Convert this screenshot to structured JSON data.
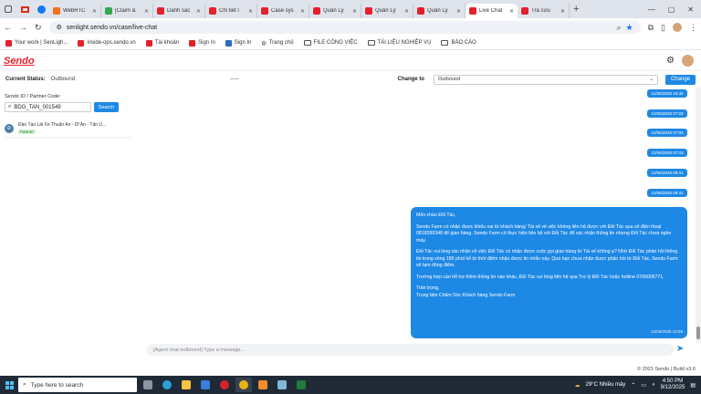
{
  "browser": {
    "tabs": [
      {
        "title": "WebRTC",
        "color": "#f2711c"
      },
      {
        "title": "[Claim &",
        "color": "#34a853"
      },
      {
        "title": "Danh sác",
        "color": "#e3212c"
      },
      {
        "title": "Chi tiết l",
        "color": "#e3212c"
      },
      {
        "title": "Case sys",
        "color": "#e3212c"
      },
      {
        "title": "Quản Lý",
        "color": "#e3212c"
      },
      {
        "title": "Quản Lý",
        "color": "#e3212c"
      },
      {
        "title": "Quản Lý",
        "color": "#e3212c"
      },
      {
        "title": "Live Chat",
        "color": "#e3212c"
      },
      {
        "title": "Tra cứu",
        "color": "#e3212c"
      }
    ],
    "url": "senlight.sendo.vn/case/live-chat",
    "bookmarks": [
      {
        "label": "Your work | SenLigh...",
        "icon": "sendo-icon"
      },
      {
        "label": "inside-ops.sendo.vn",
        "icon": "sendo-icon"
      },
      {
        "label": "Tài khoản",
        "icon": "sendo-icon"
      },
      {
        "label": "Sign In",
        "icon": "sendo-icon"
      },
      {
        "label": "Sign In",
        "icon": "signin-icon"
      },
      {
        "label": "Trang chủ",
        "icon": "globe-icon"
      },
      {
        "label": "FILE CÔNG VIỆC",
        "icon": "folder-icon"
      },
      {
        "label": "TÀI LIỆU NGHIỆP VỤ",
        "icon": "folder-icon"
      },
      {
        "label": "BÁO CÁO",
        "icon": "folder-icon"
      }
    ]
  },
  "app": {
    "logo": "Sendo",
    "status": {
      "label": "Current Status:",
      "value": "Outbound",
      "dash": "-----",
      "change_to_label": "Change to",
      "select_value": "Outbound",
      "change_button": "Change"
    },
    "left": {
      "label": "Sendo ID / Partner Code:",
      "search_value": "BDG_TAN_001549",
      "search_button": "Search",
      "result": {
        "avatar": "Đ",
        "name": "Đào Tạo Lái Xe Thuận An - Dĩ An - Tân U...",
        "tag": "Partner"
      }
    },
    "chat": {
      "timestamps": [
        "12/06/2025 15:40",
        "12/06/2025 07:03",
        "12/06/2025 07:03",
        "12/06/2025 07:03",
        "12/06/2025 09:41",
        "12/06/2025 09:42"
      ],
      "message": {
        "paragraphs": [
          "Mến chào Đối Tác,",
          "Sendo Farm có nhận được khiếu nại từ khách hàng/ Tài xế về việc không liên hệ được với Đối Tác qua số điện thoại 0818399348 để giao hàng. Sendo Farm có thực hiện liên hệ với Đối Tác để xác nhận thông tin nhưng Đối Tác chưa nghe máy.",
          "Đối Tác vui lòng xác nhận về việc Đối Tác có nhận được cuộc gọi giao hàng từ Tài xế không ạ? Nhờ Đối Tác phản hồi thông tin trong vòng 180 phút kể từ thời điểm nhận được tin nhắn này. Quá hạn chưa nhận được phản hồi từ Đối Tác, Sendo Farm sẽ tạm đóng điểm.",
          "Trường hợp cần hỗ trợ thêm thông tin nào khác, Đối Tác vui lòng liên hệ qua Trợ lý Đối Tác hoặc hotline 0766006771.",
          "Trân trọng,\nTrung tâm Chăm Sóc Khách hàng Sendo Farm"
        ],
        "time": "12/06/2025 10:59"
      },
      "composer_placeholder": "[Agent chat outbound] Type a message..."
    },
    "footer": "© 2021 Sendo | Build v3.0"
  },
  "taskbar": {
    "search_placeholder": "Type here to search",
    "weather": "29°C  Nhiều mây",
    "time": "4:50 PM",
    "date": "9/12/2025"
  }
}
